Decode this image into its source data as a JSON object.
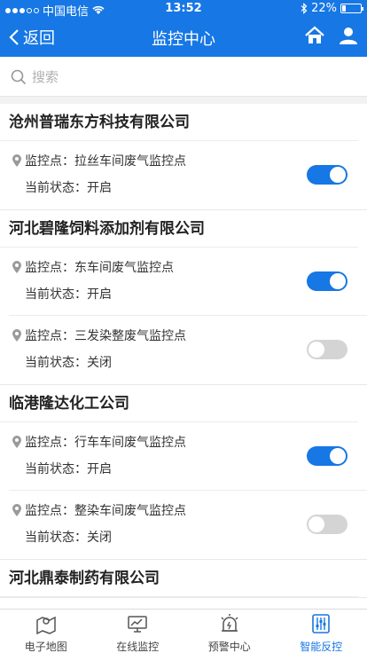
{
  "status_bar": {
    "carrier": "中国电信",
    "time": "13:52",
    "battery": "22%",
    "battery_level": 0.22
  },
  "nav": {
    "back_label": "返回",
    "title": "监控中心"
  },
  "search": {
    "placeholder": "搜索"
  },
  "companies": [
    {
      "name": "沧州普瑞东方科技有限公司",
      "points": [
        {
          "point_label": "监控点：",
          "point_name": "拉丝车间废气监控点",
          "state_label": "当前状态：",
          "state": "开启",
          "on": true
        }
      ]
    },
    {
      "name": "河北碧隆饲料添加剂有限公司",
      "points": [
        {
          "point_label": "监控点：",
          "point_name": "东车间废气监控点",
          "state_label": "当前状态：",
          "state": "开启",
          "on": true
        },
        {
          "point_label": "监控点：",
          "point_name": "三发染整废气监控点",
          "state_label": "当前状态：",
          "state": "关闭",
          "on": false
        }
      ]
    },
    {
      "name": "临港隆达化工公司",
      "points": [
        {
          "point_label": "监控点：",
          "point_name": "行车车间废气监控点",
          "state_label": "当前状态：",
          "state": "开启",
          "on": true
        },
        {
          "point_label": "监控点：",
          "point_name": "整染车间废气监控点",
          "state_label": "当前状态：",
          "state": "关闭",
          "on": false
        }
      ]
    },
    {
      "name": "河北鼎泰制药有限公司",
      "points": []
    }
  ],
  "tabs": [
    {
      "label": "电子地图",
      "icon": "map-icon",
      "active": false
    },
    {
      "label": "在线监控",
      "icon": "monitor-icon",
      "active": false
    },
    {
      "label": "预警中心",
      "icon": "alarm-icon",
      "active": false
    },
    {
      "label": "智能反控",
      "icon": "control-icon",
      "active": true
    }
  ],
  "colors": {
    "primary": "#1677e5",
    "toggle_off": "#d4d4d4"
  }
}
